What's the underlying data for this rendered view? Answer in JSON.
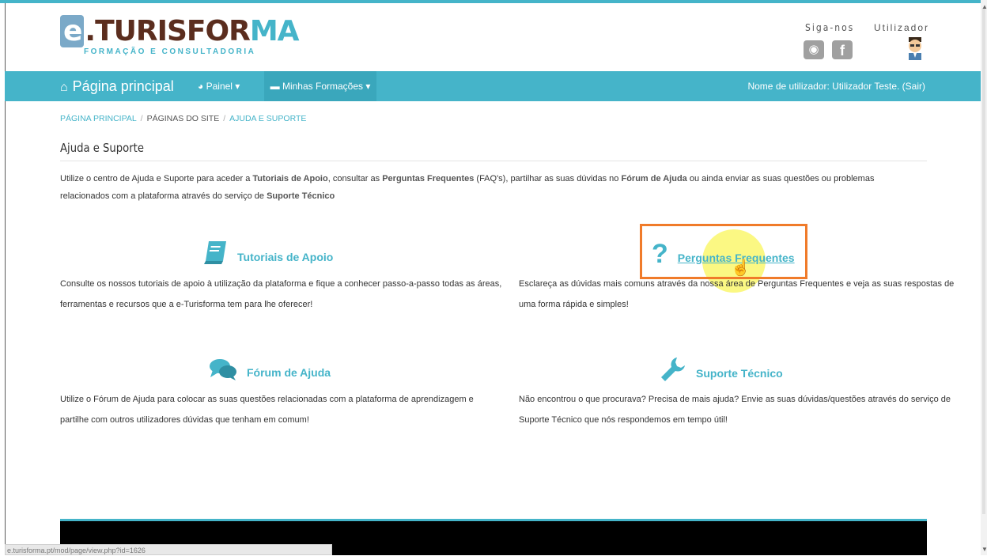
{
  "header": {
    "logo_main_e": "e",
    "logo_main_rest": ".TURISFOR",
    "logo_main_m": "MA",
    "logo_sub": "FORMAÇÃO E CONSULTADORIA",
    "follow_label": "Siga-nos",
    "user_label": "Utilizador"
  },
  "nav": {
    "home": "Página principal",
    "painel": "Painel",
    "formacoes": "Minhas Formações",
    "user_text": "Nome de utilizador: Utilizador Teste. (Sair)"
  },
  "breadcrumb": {
    "home": "PÁGINA PRINCIPAL",
    "sitepages": "PÁGINAS DO SITE",
    "current": "AJUDA E SUPORTE"
  },
  "page": {
    "title": "Ajuda e Suporte",
    "intro_1": "Utilize o centro de Ajuda e Suporte para aceder a ",
    "intro_b1": "Tutoriais de Apoio",
    "intro_2": ", consultar as ",
    "intro_b2": "Perguntas Frequentes",
    "intro_3": " (FAQ's), partilhar as suas dúvidas no ",
    "intro_b3": "Fórum de Ajuda",
    "intro_4": " ou ainda enviar as suas questões ou problemas relacionados com a plataforma através do serviço de ",
    "intro_b4": "Suporte Técnico"
  },
  "sections": {
    "tutoriais": {
      "title": "Tutoriais de Apoio",
      "text": "Consulte os nossos tutoriais de apoio à utilização da plataforma e fique a conhecer passo-a-passo todas as áreas, ferramentas e recursos que a e-Turisforma tem para lhe oferecer!"
    },
    "perguntas": {
      "title": "Perguntas Frequentes",
      "text": "Esclareça as dúvidas mais comuns através da nossa área de Perguntas Frequentes e veja as suas respostas de uma forma rápida e simples!"
    },
    "forum": {
      "title": "Fórum de Ajuda",
      "text": "Utilize o Fórum de Ajuda para colocar as suas questões relacionadas com a plataforma de aprendizagem e partilhe com outros utilizadores dúvidas que tenham em comum!"
    },
    "suporte": {
      "title": "Suporte Técnico",
      "text": "Não encontrou o que procurava? Precisa de mais ajuda? Envie as suas dúvidas/questões através do serviço de Suporte Técnico que nós respondemos em tempo útil!"
    }
  },
  "status_bar": {
    "url": "e.turisforma.pt/mod/page/view.php?id=1626"
  },
  "colors": {
    "accent": "#45b4c9",
    "highlight_border": "#f07b2a",
    "brand_brown": "#5b2d1e"
  },
  "icons": [
    "home-icon",
    "dashboard-icon",
    "courses-icon",
    "globe-icon",
    "facebook-icon",
    "avatar-icon",
    "book-icon",
    "question-icon",
    "chat-icon",
    "wrench-icon",
    "hand-cursor-icon"
  ]
}
